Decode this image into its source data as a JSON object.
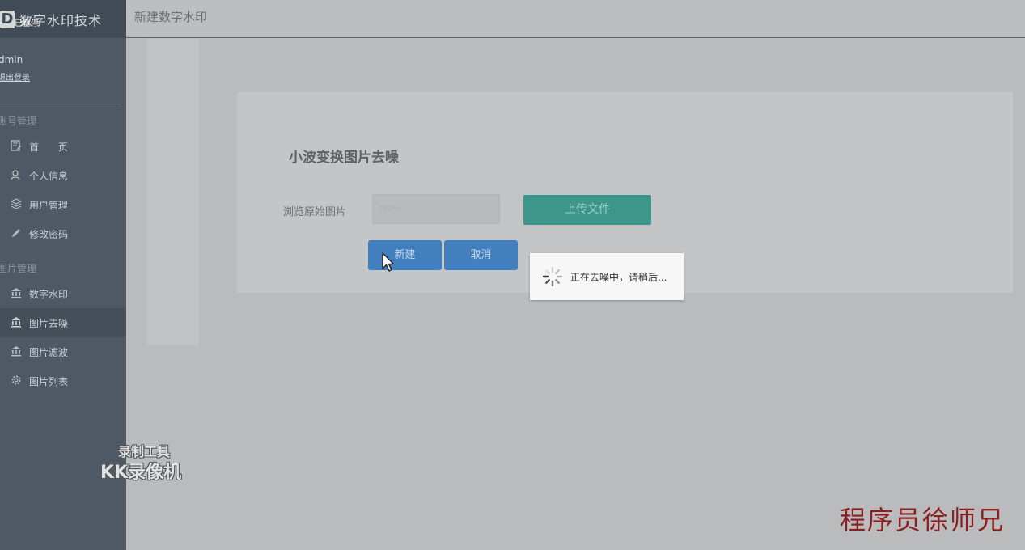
{
  "sidebar": {
    "brand_logo": "D",
    "brand_title": "数字水印技术",
    "paused_label": "已暂停",
    "user_name": "dmin",
    "logout_label": "退出登录",
    "section_account": "账号管理",
    "section_image": "图片管理",
    "items_account": [
      {
        "label": "首　　页",
        "icon": "dashboard-icon"
      },
      {
        "label": "个人信息",
        "icon": "user-icon"
      },
      {
        "label": "用户管理",
        "icon": "layers-icon"
      },
      {
        "label": "修改密码",
        "icon": "pencil-icon"
      }
    ],
    "items_image": [
      {
        "label": "数字水印",
        "icon": "bank-icon"
      },
      {
        "label": "图片去噪",
        "icon": "bank-icon",
        "active": true
      },
      {
        "label": "图片滤波",
        "icon": "bank-icon"
      },
      {
        "label": "图片列表",
        "icon": "gear-icon"
      }
    ]
  },
  "topbar": {
    "title": "新建数字水印"
  },
  "form": {
    "title": "小波变换图片去噪",
    "file_label": "浏览原始图片",
    "file_placeholder": "none",
    "upload_label": "上传文件",
    "new_label": "新建",
    "cancel_label": "取消"
  },
  "loading": {
    "text": "正在去噪中，请稍后..."
  },
  "watermarks": {
    "tool_line1": "录制工具",
    "tool_line2": "KK录像机",
    "author": "程序员徐师兄"
  },
  "colors": {
    "sidebar": "#4e5965",
    "upload_button": "#3d968a",
    "primary_button": "#417fbf",
    "author_text": "#8b1e1e"
  }
}
